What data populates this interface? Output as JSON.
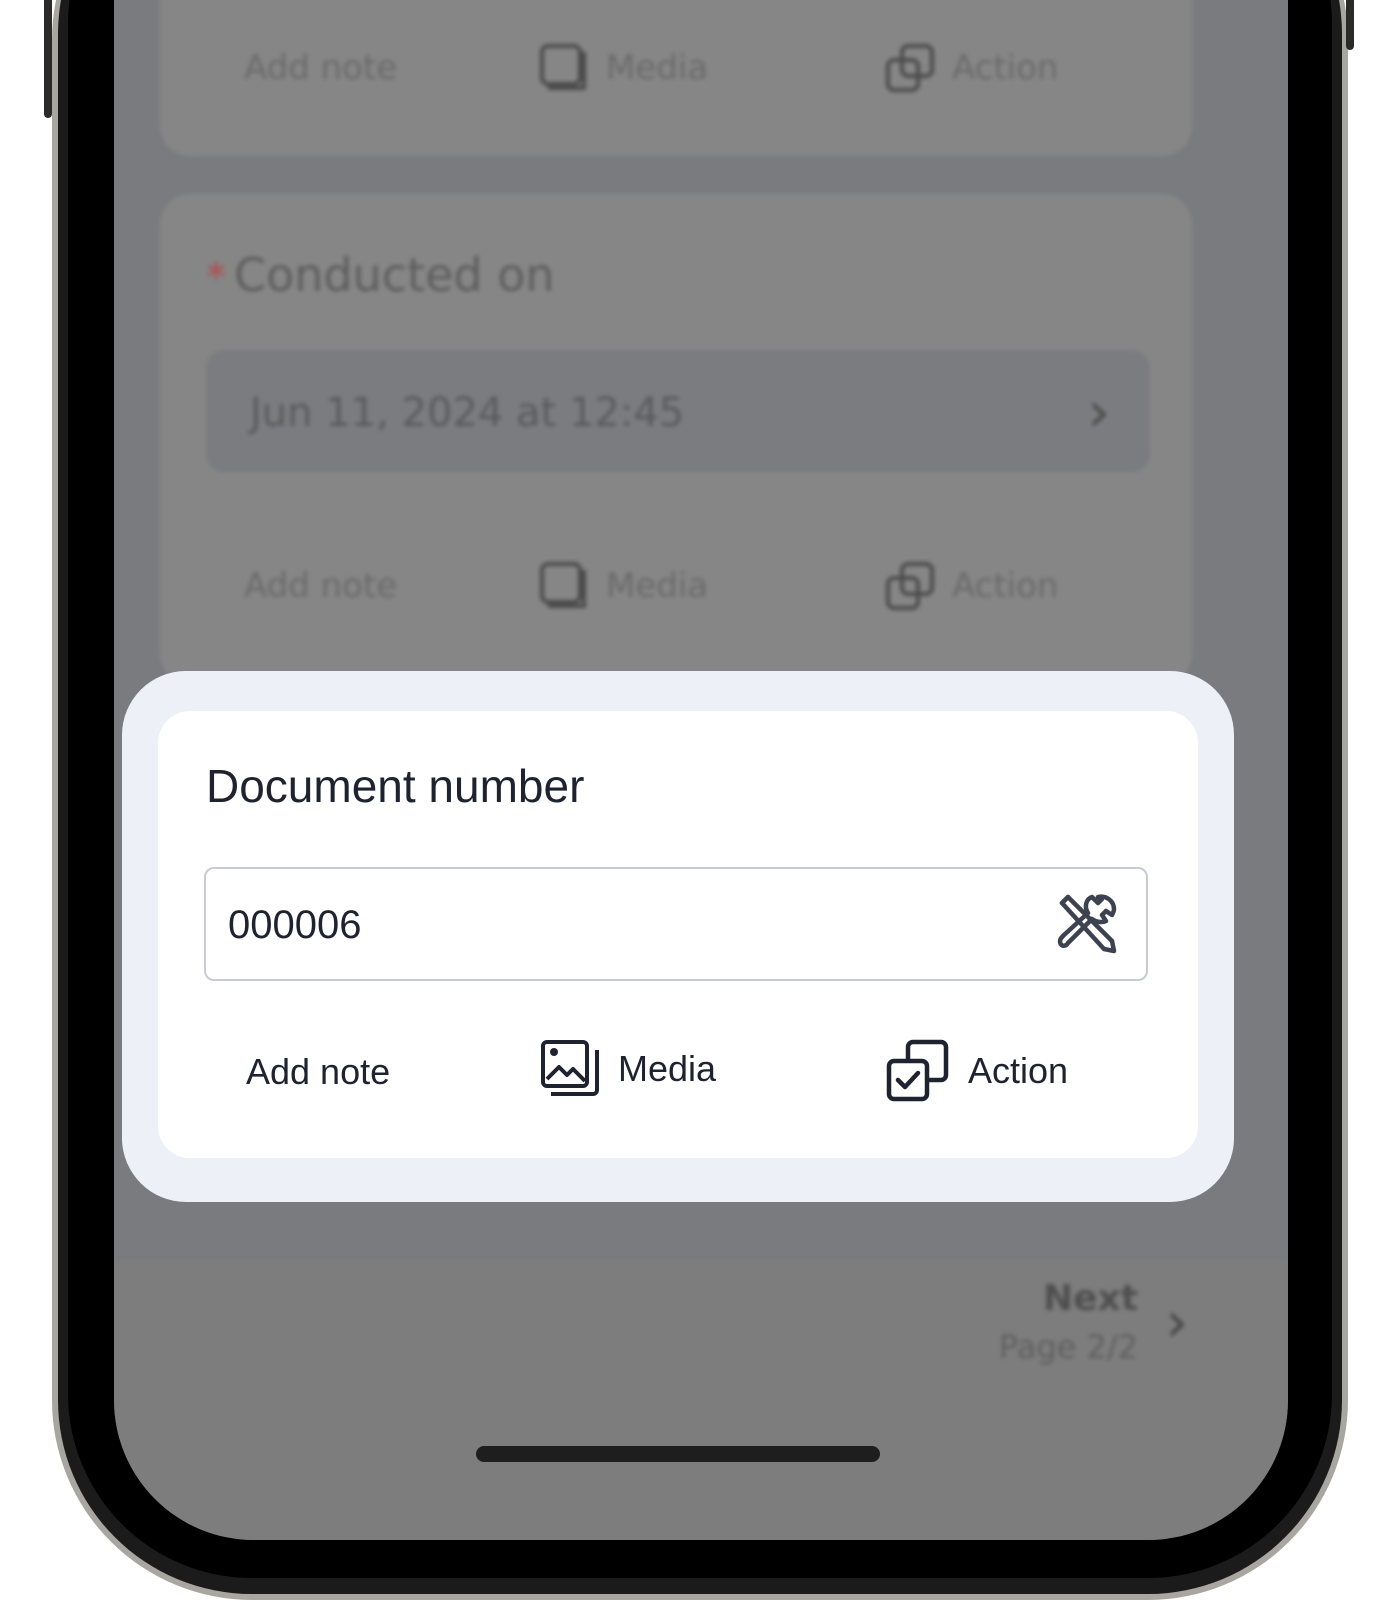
{
  "background": {
    "top_actions": {
      "add_note": "Add note",
      "media": "Media",
      "action": "Action"
    },
    "conducted_on": {
      "required_marker": "*",
      "label": "Conducted on",
      "value": "Jun 11, 2024 at 12:45",
      "actions": {
        "add_note": "Add note",
        "media": "Media",
        "action": "Action"
      }
    },
    "footer": {
      "next_label": "Next",
      "page_label": "Page 2/2"
    }
  },
  "card": {
    "title": "Document number",
    "input_value": "000006",
    "input_icon": "tools-icon",
    "actions": {
      "add_note": "Add note",
      "media": "Media",
      "media_icon": "image-icon",
      "action": "Action",
      "action_icon": "action-checkbox-icon"
    }
  },
  "colors": {
    "highlight": "#eef0f8",
    "text": "#1f2330",
    "required": "#b24a4a"
  }
}
